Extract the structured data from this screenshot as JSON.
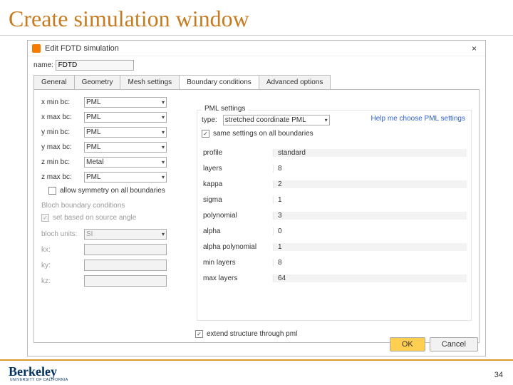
{
  "slide": {
    "title": "Create simulation window",
    "page_num": "34",
    "footer_brand": "Berkeley",
    "footer_sub": "UNIVERSITY OF CALIFORNIA"
  },
  "win": {
    "title": "Edit FDTD simulation",
    "close_icon": "×",
    "name_label": "name:",
    "name_value": "FDTD",
    "tabs": [
      "General",
      "Geometry",
      "Mesh settings",
      "Boundary conditions",
      "Advanced options"
    ],
    "active_tab": 3,
    "left": {
      "rows": [
        {
          "label": "x min bc:",
          "value": "PML"
        },
        {
          "label": "x max bc:",
          "value": "PML"
        },
        {
          "label": "y min bc:",
          "value": "PML"
        },
        {
          "label": "y max bc:",
          "value": "PML"
        },
        {
          "label": "z min bc:",
          "value": "Metal"
        },
        {
          "label": "z max bc:",
          "value": "PML"
        }
      ],
      "allow_symmetry": "allow symmetry on all boundaries",
      "bloch_header": "Bloch boundary conditions",
      "set_based": "set based on source angle",
      "units_label": "bloch units:",
      "units_value": "SI",
      "kx": "kx:",
      "ky": "ky:",
      "kz": "kz:"
    },
    "right": {
      "legend": "PML settings",
      "type_label": "type:",
      "type_value": "stretched coordinate PML",
      "help_link": "Help me choose PML settings",
      "same_settings": "same settings on all boundaries",
      "table": [
        {
          "label": "profile",
          "value": "standard"
        },
        {
          "label": "layers",
          "value": "8"
        },
        {
          "label": "kappa",
          "value": "2"
        },
        {
          "label": "sigma",
          "value": "1"
        },
        {
          "label": "polynomial",
          "value": "3"
        },
        {
          "label": "alpha",
          "value": "0"
        },
        {
          "label": "alpha polynomial",
          "value": "1"
        },
        {
          "label": "min layers",
          "value": "8"
        },
        {
          "label": "max layers",
          "value": "64"
        }
      ],
      "extend": "extend structure through pml"
    },
    "ok": "OK",
    "cancel": "Cancel"
  }
}
